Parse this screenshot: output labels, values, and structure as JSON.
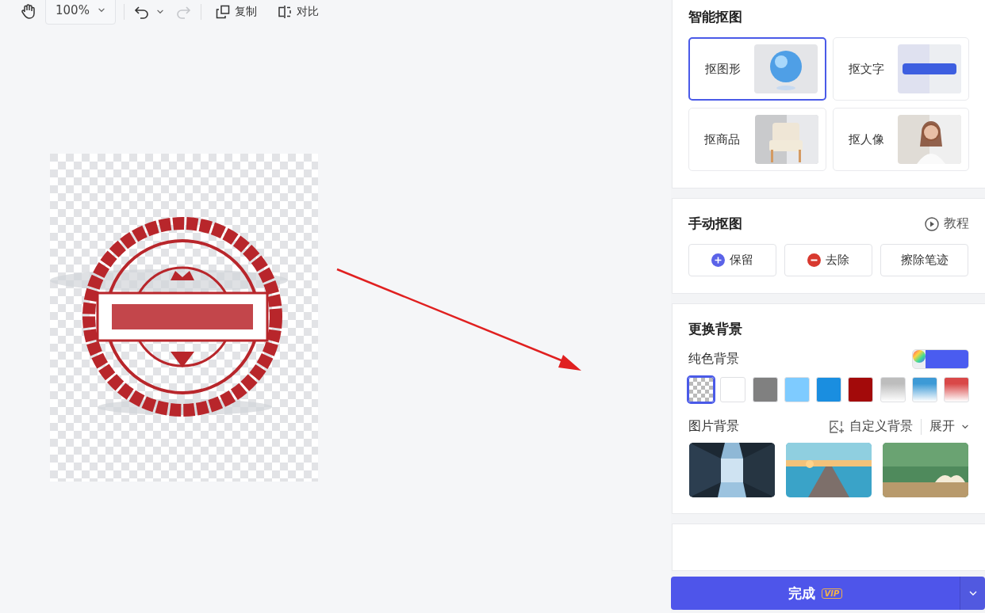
{
  "toolbar": {
    "zoom": "100%",
    "undo_enabled": true,
    "redo_enabled": false,
    "actions": [
      {
        "kind": "copy",
        "label": "复制"
      },
      {
        "kind": "compare",
        "label": "对比"
      }
    ]
  },
  "smart_cutout": {
    "title": "智能抠图",
    "options": [
      {
        "label": "抠图形",
        "selected": true
      },
      {
        "label": "抠文字",
        "selected": false
      },
      {
        "label": "抠商品",
        "selected": false
      },
      {
        "label": "抠人像",
        "selected": false
      }
    ]
  },
  "manual_cutout": {
    "title": "手动抠图",
    "tutorial": "教程",
    "buttons": [
      {
        "kind": "keep",
        "label": "保留"
      },
      {
        "kind": "remove",
        "label": "去除"
      },
      {
        "kind": "erase",
        "label": "擦除笔迹"
      }
    ]
  },
  "background": {
    "title": "更换背景",
    "solid_label": "纯色背景",
    "swatches": [
      {
        "kind": "transparent",
        "selected": true
      },
      {
        "kind": "solid",
        "color": "#ffffff",
        "selected": false
      },
      {
        "kind": "solid",
        "color": "#808080",
        "selected": false
      },
      {
        "kind": "solid",
        "color": "#7ecbff",
        "selected": false
      },
      {
        "kind": "solid",
        "color": "#1a8ee0",
        "selected": false
      },
      {
        "kind": "solid",
        "color": "#a30a0a",
        "selected": false
      },
      {
        "kind": "gradient",
        "color": "#bdbdbd",
        "selected": false
      },
      {
        "kind": "gradient",
        "color": "#3d9ad6",
        "selected": false
      },
      {
        "kind": "gradient",
        "color": "#d94848",
        "selected": false
      }
    ],
    "picture_label": "图片背景",
    "custom": "自定义背景",
    "expand": "展开"
  },
  "done_button": {
    "label": "完成",
    "badge": "VIP"
  }
}
